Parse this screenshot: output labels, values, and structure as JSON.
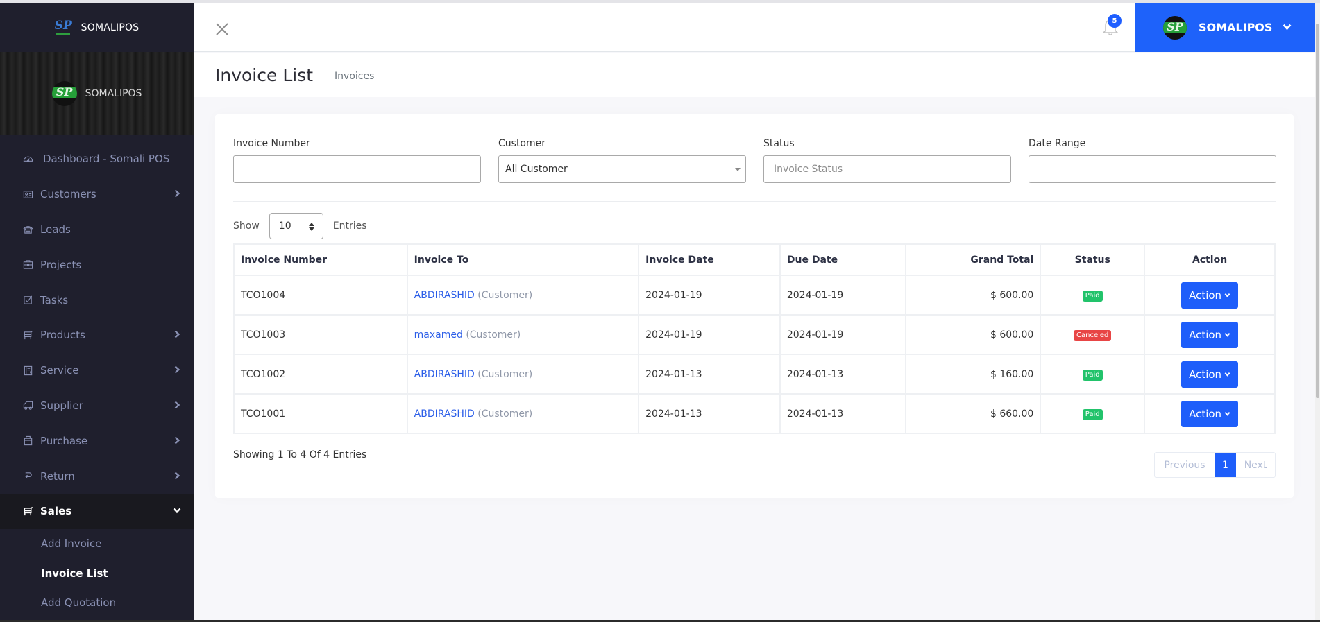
{
  "app": {
    "brand": "SOMALIPOS",
    "banner_brand": "SOMALIPOS",
    "logo_letters": "SP"
  },
  "sidebar": {
    "items": [
      {
        "label": "Dashboard - Somali POS",
        "icon": "dashboard-gauge-icon",
        "has_children": false
      },
      {
        "label": "Customers",
        "icon": "id-card-icon",
        "has_children": true
      },
      {
        "label": "Leads",
        "icon": "phone-icon",
        "has_children": false
      },
      {
        "label": "Projects",
        "icon": "briefcase-icon",
        "has_children": false
      },
      {
        "label": "Tasks",
        "icon": "checkbox-icon",
        "has_children": false
      },
      {
        "label": "Products",
        "icon": "cart-icon",
        "has_children": true
      },
      {
        "label": "Service",
        "icon": "book-icon",
        "has_children": true
      },
      {
        "label": "Supplier",
        "icon": "truck-icon",
        "has_children": true
      },
      {
        "label": "Purchase",
        "icon": "bag-icon",
        "has_children": true
      },
      {
        "label": "Return",
        "icon": "return-arrow-icon",
        "has_children": true
      },
      {
        "label": "Sales",
        "icon": "cart-icon",
        "has_children": true,
        "expanded": true
      }
    ],
    "sales_submenu": [
      {
        "label": "Add Invoice"
      },
      {
        "label": "Invoice List",
        "current": true
      },
      {
        "label": "Add Quotation"
      }
    ]
  },
  "header": {
    "notification_count": "5",
    "user_name": "SOMALIPOS"
  },
  "page": {
    "title": "Invoice List",
    "breadcrumb": "Invoices"
  },
  "filters": {
    "invoice_number": {
      "label": "Invoice Number",
      "value": ""
    },
    "customer": {
      "label": "Customer",
      "value": "All Customer"
    },
    "status": {
      "label": "Status",
      "placeholder": "Invoice Status"
    },
    "date_range": {
      "label": "Date Range",
      "value": ""
    }
  },
  "entries": {
    "show_label": "Show",
    "value": "10",
    "entries_label": "Entries"
  },
  "table": {
    "columns": [
      "Invoice Number",
      "Invoice To",
      "Invoice Date",
      "Due Date",
      "Grand Total",
      "Status",
      "Action"
    ],
    "rows": [
      {
        "number": "TCO1004",
        "customer": "ABDIRASHID",
        "customer_type": "(Customer)",
        "invoice_date": "2024-01-19",
        "due_date": "2024-01-19",
        "total": "$ 600.00",
        "status": "Paid",
        "action": "Action"
      },
      {
        "number": "TCO1003",
        "customer": "maxamed",
        "customer_type": "(Customer)",
        "invoice_date": "2024-01-19",
        "due_date": "2024-01-19",
        "total": "$ 600.00",
        "status": "Canceled",
        "action": "Action"
      },
      {
        "number": "TCO1002",
        "customer": "ABDIRASHID",
        "customer_type": "(Customer)",
        "invoice_date": "2024-01-13",
        "due_date": "2024-01-13",
        "total": "$ 160.00",
        "status": "Paid",
        "action": "Action"
      },
      {
        "number": "TCO1001",
        "customer": "ABDIRASHID",
        "customer_type": "(Customer)",
        "invoice_date": "2024-01-13",
        "due_date": "2024-01-13",
        "total": "$ 660.00",
        "status": "Paid",
        "action": "Action"
      }
    ]
  },
  "footer": {
    "showing": "Showing 1 To 4 Of 4 Entries",
    "previous": "Previous",
    "page": "1",
    "next": "Next"
  },
  "colors": {
    "primary": "#1e5efa",
    "paid": "#22c36b",
    "canceled": "#e84545",
    "sidebar_bg": "#1f1f2d"
  }
}
